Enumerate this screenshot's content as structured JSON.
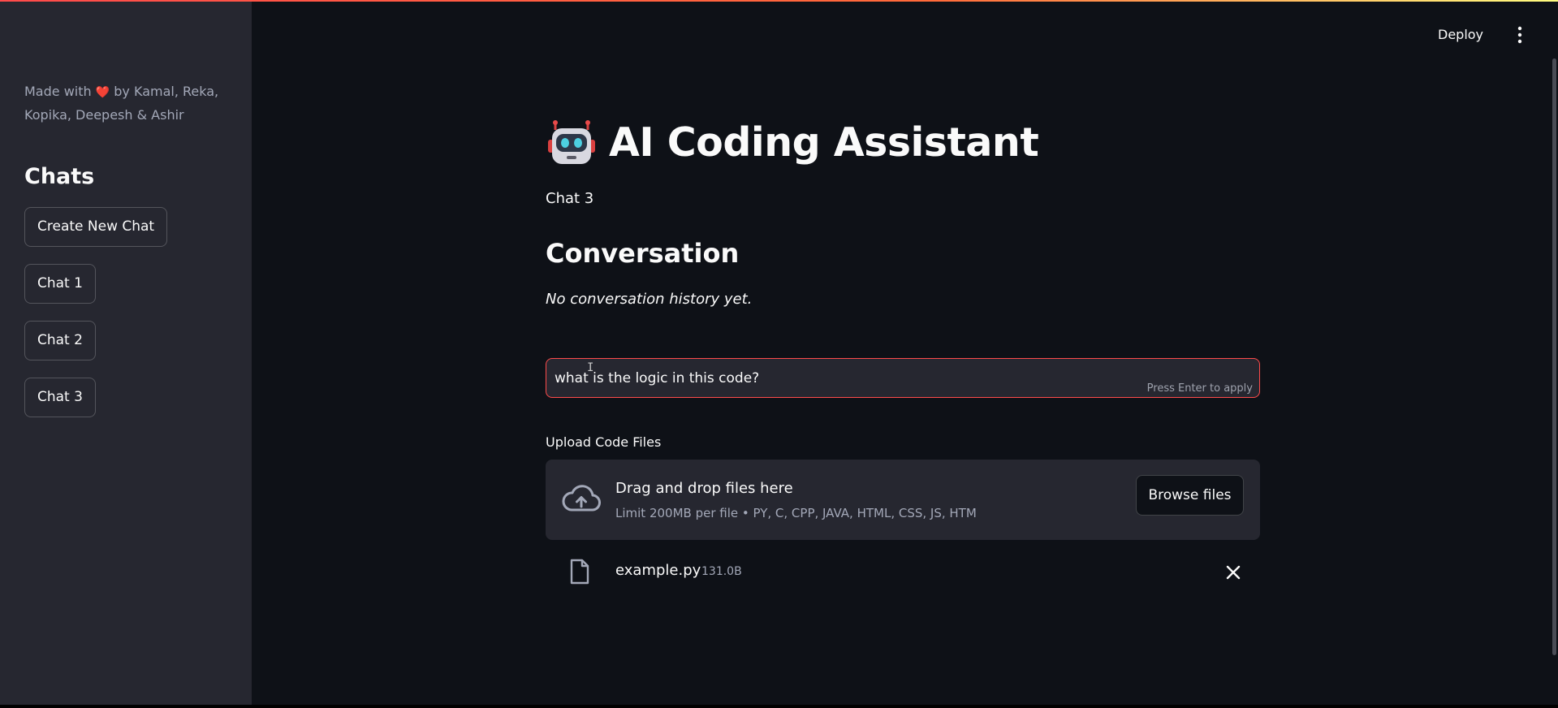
{
  "sidebar": {
    "credits_prefix": "Made with",
    "credits_heart": "❤️",
    "credits_suffix": "by Kamal, Reka, Kopika, Deepesh & Ashir",
    "chats_heading": "Chats",
    "create_button": "Create New Chat",
    "chat_items": [
      "Chat 1",
      "Chat 2",
      "Chat 3"
    ]
  },
  "header": {
    "deploy_label": "Deploy",
    "menu_icon": "kebab-menu-icon"
  },
  "main": {
    "title_icon": "robot-icon",
    "title": "AI Coding Assistant",
    "current_chat": "Chat 3",
    "conversation_heading": "Conversation",
    "empty_history": "No conversation history yet.",
    "query": {
      "value": "what is the logic in this code?",
      "hint": "Press Enter to apply"
    },
    "uploader": {
      "label": "Upload Code Files",
      "drop_text": "Drag and drop files here",
      "limit_text": "Limit 200MB per file • PY, C, CPP, JAVA, HTML, CSS, JS, HTM",
      "browse_label": "Browse files",
      "icon": "cloud-upload-icon"
    },
    "uploaded_file": {
      "name": "example.py",
      "size": "131.0B",
      "icon": "file-icon",
      "remove_icon": "close-icon"
    }
  },
  "colors": {
    "background": "#0e1117",
    "sidebar": "#262730",
    "accent": "#ff4b4b",
    "text": "#fafafa",
    "muted_text": "#a3a8b8"
  }
}
